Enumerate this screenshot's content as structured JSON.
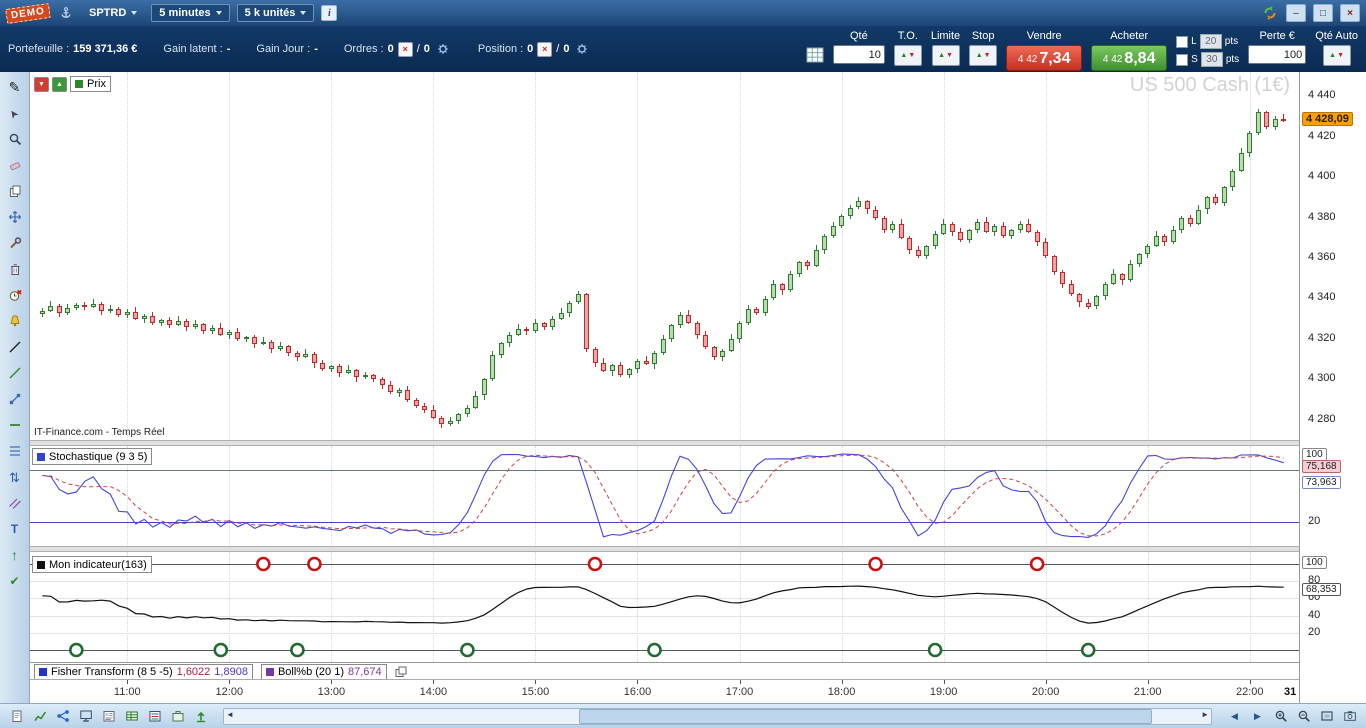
{
  "titlebar": {
    "demo_badge": "DEMO",
    "instrument": "SPTRD",
    "timeframe": "5 minutes",
    "units": "5 k unités",
    "info": "i"
  },
  "icons": {
    "minimize": "–",
    "maximize": "□",
    "close": "×",
    "up_arrow": "▲",
    "down_arrow": "▼",
    "left_arrow": "◄",
    "right_arrow": "►"
  },
  "tradebar": {
    "portfolio_label": "Portefeuille :",
    "portfolio_value": "159 371,36 €",
    "gain_latent_label": "Gain latent :",
    "gain_latent_value": "-",
    "gain_jour_label": "Gain Jour :",
    "gain_jour_value": "-",
    "ordres_label": "Ordres :",
    "ordres_value": "0",
    "ordres_value2": "0",
    "position_label": "Position :",
    "position_value": "0",
    "position_value2": "0",
    "sep": "/",
    "qte_label": "Qté",
    "qte_value": "10",
    "to_label": "T.O.",
    "limite_label": "Limite",
    "stop_label": "Stop",
    "vendre_label": "Vendre",
    "vendre_price_small": "4 42",
    "vendre_price_big": "7,34",
    "acheter_label": "Acheter",
    "acheter_price_small": "4 42",
    "acheter_price_big": "8,84",
    "l_label": "L",
    "l_value": "20",
    "l_unit": "pts",
    "s_label": "S",
    "s_value": "30",
    "s_unit": "pts",
    "perte_label": "Perte €",
    "perte_value": "100",
    "qte_auto_label": "Qté Auto"
  },
  "chart": {
    "watermark": "US 500 Cash (1€)",
    "copyright": "IT-Finance.com - Temps Réel",
    "prix_label": "Prix",
    "last_price": "4 428,09",
    "price_axis": [
      "4 440",
      "4 420",
      "4 400",
      "4 380",
      "4 360",
      "4 340",
      "4 320",
      "4 300",
      "4 280"
    ],
    "time_axis": [
      "11:00",
      "12:00",
      "13:00",
      "14:00",
      "15:00",
      "16:00",
      "17:00",
      "18:00",
      "19:00",
      "20:00",
      "21:00",
      "22:00"
    ],
    "day_label": "31"
  },
  "stoch": {
    "label": "Stochastique (9 3 5)",
    "top_scale": "100",
    "bottom_scale": "20",
    "k_value": "75,168",
    "d_value": "73,963"
  },
  "indicator": {
    "label": "Mon indicateur(163)",
    "scale": [
      "100",
      "80",
      "60",
      "40",
      "20"
    ],
    "value": "68,353"
  },
  "bottom_labels": {
    "fisher": "Fisher Transform (8 5 -5)",
    "fisher_v1": "1,6022",
    "fisher_v2": "1,8908",
    "bollb": "Boll%b (20 1)",
    "bollb_v": "87,674"
  },
  "sidebar": {
    "tools": [
      "pencil",
      "cursor",
      "zoom",
      "eraser",
      "copy",
      "move",
      "tools",
      "trash",
      "alarm",
      "bell",
      "trendline",
      "trendline-green",
      "segment",
      "horizontal-line",
      "fibonacci",
      "updown",
      "channel",
      "text",
      "arrow-up",
      "check"
    ]
  },
  "bottombar": {
    "left_tools": [
      "page",
      "chart",
      "share",
      "monitor",
      "news",
      "table",
      "watchlist",
      "portfolio",
      "export"
    ],
    "right_tools": [
      "prev",
      "next",
      "zoom-in",
      "zoom-out",
      "fullscreen",
      "snapshot"
    ]
  },
  "colors": {
    "sell_red": "#c43020",
    "buy_green": "#3f9030",
    "last_price_badge": "#ff9e00",
    "stoch_k_blue": "#4444dd",
    "stoch_d_red": "#cc4444",
    "up_candle": "#b9dcab",
    "down_candle": "#e9a6a6",
    "fisher_blue": "#2233cc",
    "bollb_purple": "#7a35a8",
    "red_signal": "#cc1111",
    "green_signal": "#1f6b30"
  },
  "chart_data": {
    "type": "candlestick",
    "title": "US 500 Cash (1€)",
    "timeframe": "5 minutes",
    "start_time": "10:10",
    "interval_minutes": 5,
    "ylim": [
      4270,
      4452
    ],
    "grid_step": 20,
    "closes": [
      4334,
      4336.5,
      4333,
      4335.5,
      4337,
      4336,
      4337.5,
      4334,
      4335,
      4332,
      4333.5,
      4330,
      4331.5,
      4328,
      4329.5,
      4327,
      4329,
      4326,
      4327.5,
      4324,
      4325.5,
      4322,
      4323.5,
      4320,
      4321,
      4317.5,
      4318.5,
      4315,
      4316.5,
      4313,
      4311,
      4312.5,
      4308,
      4305,
      4306.5,
      4303,
      4304.5,
      4301,
      4302,
      4300,
      4297,
      4293.5,
      4295,
      4290,
      4287,
      4285,
      4281,
      4278,
      4279.5,
      4283,
      4286,
      4292,
      4300,
      4312,
      4318,
      4322,
      4325,
      4324,
      4328,
      4326,
      4330,
      4333,
      4338,
      4342,
      4315,
      4308,
      4304,
      4307,
      4302,
      4305,
      4309,
      4307.5,
      4313,
      4320,
      4327,
      4332,
      4328,
      4322,
      4316,
      4311,
      4314,
      4320,
      4328,
      4335,
      4333,
      4340,
      4347,
      4344,
      4352,
      4358,
      4356,
      4364,
      4371,
      4376,
      4381,
      4385,
      4388,
      4384,
      4380,
      4374,
      4377,
      4370,
      4364,
      4361,
      4366,
      4372,
      4377,
      4373,
      4369,
      4374,
      4378,
      4373,
      4376,
      4371,
      4374,
      4377,
      4373,
      4368,
      4361,
      4353,
      4347,
      4342,
      4338,
      4336,
      4341,
      4347,
      4352,
      4349,
      4357,
      4362,
      4366,
      4371,
      4368,
      4374,
      4380,
      4377,
      4384,
      4390,
      4387,
      4395,
      4403,
      4412,
      4422,
      4432,
      4425,
      4429,
      4428
    ],
    "stochastic_params": {
      "k_period": 9,
      "k_smoothing": 3,
      "d_period": 5
    },
    "stochastic_last": {
      "k": 75.168,
      "d": 73.963
    },
    "mon_indicateur_last": 68.353,
    "last_price": 4428.09,
    "red_signals": [
      "12:20",
      "12:50",
      "15:35",
      "18:20",
      "19:55"
    ],
    "green_signals": [
      "10:30",
      "11:55",
      "12:40",
      "14:20",
      "16:10",
      "18:55",
      "20:25"
    ]
  }
}
